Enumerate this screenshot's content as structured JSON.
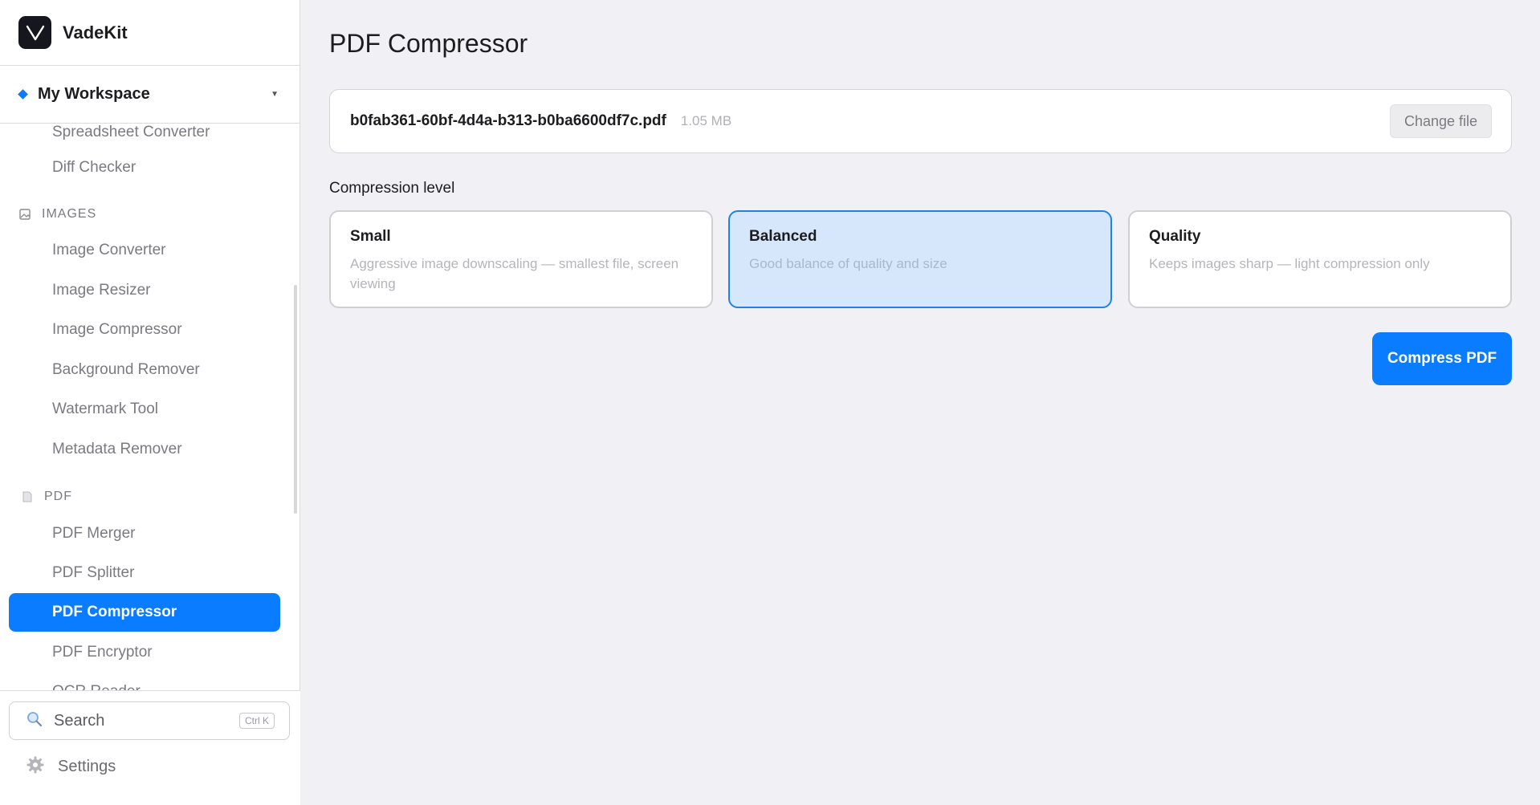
{
  "app": {
    "name": "VadeKit"
  },
  "workspace": {
    "label": "My Workspace"
  },
  "sidebar": {
    "sections": [
      {
        "id": "images",
        "label": "IMAGES"
      },
      {
        "id": "pdf",
        "label": "PDF"
      }
    ],
    "items": [
      {
        "label": "Spreadsheet Converter"
      },
      {
        "label": "Diff Checker"
      },
      {
        "label": "Image Converter"
      },
      {
        "label": "Image Resizer"
      },
      {
        "label": "Image Compressor"
      },
      {
        "label": "Background Remover"
      },
      {
        "label": "Watermark Tool"
      },
      {
        "label": "Metadata Remover"
      },
      {
        "label": "PDF Merger"
      },
      {
        "label": "PDF Splitter"
      },
      {
        "label": "PDF Compressor"
      },
      {
        "label": "PDF Encryptor"
      },
      {
        "label": "OCR Reader"
      }
    ],
    "active_item": "PDF Compressor"
  },
  "search": {
    "label": "Search",
    "shortcut": "Ctrl K"
  },
  "settings": {
    "label": "Settings"
  },
  "main": {
    "title": "PDF Compressor",
    "file": {
      "name": "b0fab361-60bf-4d4a-b313-b0ba6600df7c.pdf",
      "size": "1.05 MB",
      "change_label": "Change file"
    },
    "compression_label": "Compression level",
    "options": [
      {
        "title": "Small",
        "desc": "Aggressive image downscaling — smallest file, screen viewing",
        "selected": false
      },
      {
        "title": "Balanced",
        "desc": "Good balance of quality and size",
        "selected": true
      },
      {
        "title": "Quality",
        "desc": "Keeps images sharp — light compression only",
        "selected": false
      }
    ],
    "action_label": "Compress PDF"
  },
  "colors": {
    "accent": "#0a7cff",
    "selected_bg": "#d6e6fb",
    "selected_border": "#1e83e6",
    "page_bg": "#f0f0f5"
  }
}
